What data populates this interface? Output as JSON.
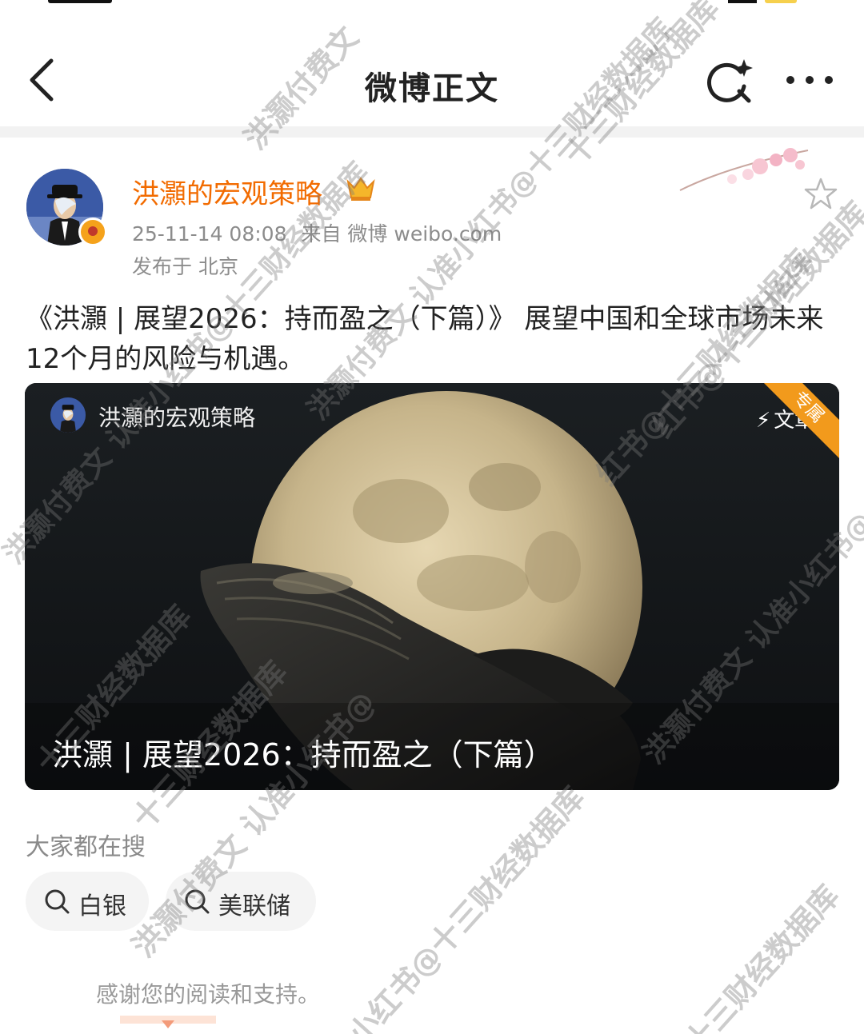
{
  "navbar": {
    "title": "微博正文"
  },
  "post": {
    "author": "洪灝的宏观策略",
    "timestamp": "25-11-14 08:08",
    "source": "来自 微博 weibo.com",
    "location": "发布于 北京",
    "text": "《洪灝 | 展望2026：持而盈之（下篇）》 展望中国和全球市场未来12个月的风险与机遇。"
  },
  "card": {
    "author": "洪灝的宏观策略",
    "type_label": "文章",
    "ribbon": "专属",
    "title": "洪灝 | 展望2026：持而盈之（下篇）"
  },
  "trending": {
    "label": "大家都在搜",
    "chips": [
      "白银",
      "美联储"
    ]
  },
  "footer": {
    "thanks": "感谢您的阅读和支持。"
  },
  "watermarks": [
    "洪灏付费文",
    "十三财经数据库",
    "洪灏付费文 认准小红书@十三财经数据库",
    "十三财经数据库",
    "洪灏付费文 认准小红书@十三财经数据库",
    "红书@十三财经数据库",
    "洪灏付费文 认准小红书@十三财经数据库",
    "红书@十三财经数据库",
    "洪灏付费文 认准小红书@",
    "十三财经数据库",
    "小红书@十三财经数据库",
    "十三财经数据库"
  ],
  "colors": {
    "accent": "#f26b00",
    "ribbon": "#f29a1c",
    "meta": "#8c8c8c"
  },
  "icons": [
    "back-arrow-icon",
    "search-sparkle-icon",
    "more-dots-icon",
    "crown-badge-icon",
    "star-icon",
    "lightning-icon",
    "magnifier-icon"
  ]
}
